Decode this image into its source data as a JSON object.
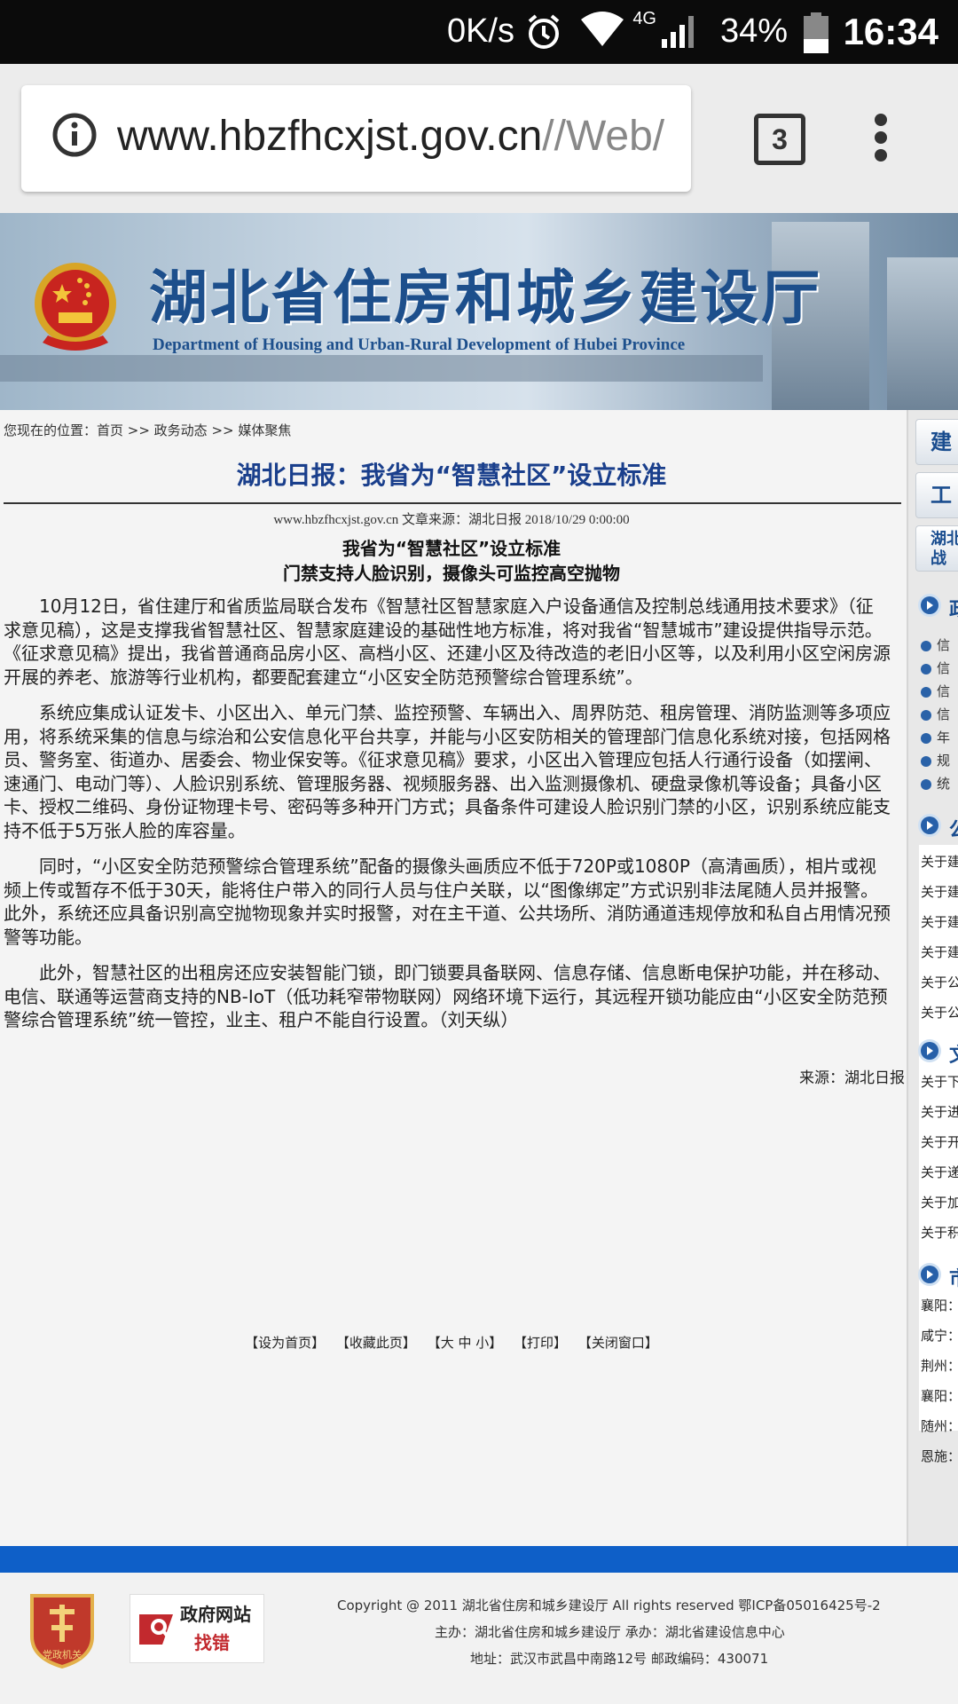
{
  "status_bar": {
    "speed": "0K/s",
    "network": "4G",
    "battery": "34%",
    "time": "16:34",
    "icons": [
      "alarm-icon",
      "wifi-icon",
      "signal-icon",
      "battery-icon"
    ]
  },
  "browser": {
    "url_main": "www.hbzfhcxjst.gov.cn",
    "url_rest": "//Web/",
    "tab_count": "3"
  },
  "banner": {
    "title": "湖北省住房和城乡建设厅",
    "subtitle": "Department of Housing and Urban-Rural Development of Hubei Province"
  },
  "article": {
    "breadcrumb": "您现在的位置：首页 >> 政务动态 >> 媒体聚焦",
    "title": "湖北日报：我省为“智慧社区”设立标准",
    "meta": "www.hbzfhcxjst.gov.cn  文章来源：湖北日报  2018/10/29 0:00:00",
    "headline1": "我省为“智慧社区”设立标准",
    "headline2": "门禁支持人脸识别，摄像头可监控高空抛物",
    "paragraphs": [
      "10月12日，省住建厅和省质监局联合发布《智慧社区智慧家庭入户设备通信及控制总线通用技术要求》（征求意见稿），这是支撑我省智慧社区、智慧家庭建设的基础性地方标准，将对我省“智慧城市”建设提供指导示范。《征求意见稿》提出，我省普通商品房小区、高档小区、还建小区及待改造的老旧小区等，以及利用小区空闲房源开展的养老、旅游等行业机构，都要配套建立“小区安全防范预警综合管理系统”。",
      "系统应集成认证发卡、小区出入、单元门禁、监控预警、车辆出入、周界防范、租房管理、消防监测等多项应用，将系统采集的信息与综治和公安信息化平台共享，并能与小区安防相关的管理部门信息化系统对接，包括网格员、警务室、街道办、居委会、物业保安等。《征求意见稿》要求，小区出入管理应包括人行通行设备（如摆闸、速通门、电动门等）、人脸识别系统、管理服务器、视频服务器、出入监测摄像机、硬盘录像机等设备；具备小区卡、授权二维码、身份证物理卡号、密码等多种开门方式；具备条件可建设人脸识别门禁的小区，识别系统应能支持不低于5万张人脸的库容量。",
      "同时，“小区安全防范预警综合管理系统”配备的摄像头画质应不低于720P或1080P（高清画质），相片或视频上传或暂存不低于30天，能将住户带入的同行人员与住户关联，以“图像绑定”方式识别非法尾随人员并报警。此外，系统还应具备识别高空抛物现象并实时报警，对在主干道、公共场所、消防通道违规停放和私自占用情况预警等功能。",
      "此外，智慧社区的出租房还应安装智能门锁，即门锁要具备联网、信息存储、信息断电保护功能，并在移动、电信、联通等运营商支持的NB-IoT（低功耗窄带物联网）网络环境下运行，其远程开锁功能应由“小区安全防范预警综合管理系统”统一管控，业主、租户不能自行设置。（刘天纵）"
    ],
    "source": "来源：湖北日报",
    "tools": [
      "【设为首页】",
      "【收藏此页】",
      "【大 中 小】",
      "【打印】",
      "【关闭窗口】"
    ]
  },
  "sidebar": {
    "btn1": "建",
    "btn2": "工",
    "btn3_line1": "湖北",
    "btn3_line2": "战",
    "head1": "政",
    "list1": [
      "信",
      "信",
      "信",
      "信",
      "年",
      "规",
      "统"
    ],
    "head2": "公",
    "list2": [
      "关于建",
      "关于建",
      "关于建",
      "关于建",
      "关于公",
      "关于公"
    ],
    "head3": "文",
    "list3": [
      "关于下",
      "关于进",
      "关于开",
      "关于递",
      "关于加",
      "关于积"
    ],
    "head4": "市",
    "list4": [
      "襄阳：",
      "咸宁：",
      "荆州：",
      "襄阳：",
      "随州：",
      "恩施："
    ]
  },
  "footer": {
    "badge_label": "党政机关",
    "gov_find_line1": "政府网站",
    "gov_find_line2": "找错",
    "copyright": "Copyright @ 2011 湖北省住房和城乡建设厅 All rights reserved 鄂ICP备05016425号-2",
    "host": "主办：湖北省住房和城乡建设厅 承办：湖北省建设信息中心",
    "address": "地址：武汉市武昌中南路12号 邮政编码：430071"
  }
}
